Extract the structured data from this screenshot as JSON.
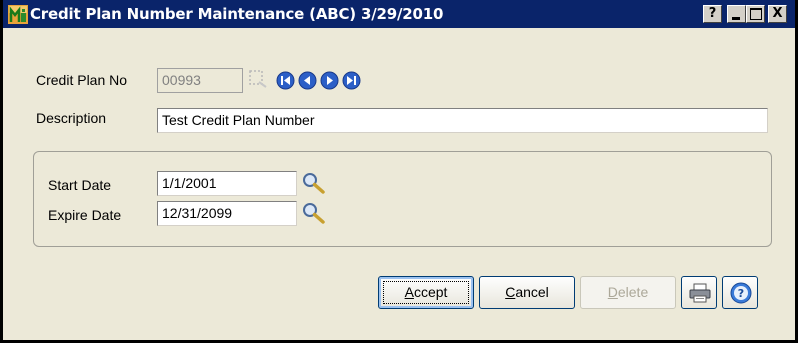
{
  "window": {
    "title": "Credit Plan Number Maintenance (ABC) 3/29/2010",
    "help_button": "?",
    "minimize_button": "_",
    "maximize_button": "□",
    "close_button": "X"
  },
  "form": {
    "credit_plan_no_label": "Credit Plan No",
    "credit_plan_no_value": "00993",
    "description_label": "Description",
    "description_value": "Test Credit Plan Number",
    "start_date_label": "Start Date",
    "start_date_value": "1/1/2001",
    "expire_date_label": "Expire Date",
    "expire_date_value": "12/31/2099"
  },
  "buttons": {
    "accept_access": "A",
    "accept_rest": "ccept",
    "cancel_access": "C",
    "cancel_rest": "ancel",
    "delete_access": "D",
    "delete_rest": "elete"
  },
  "icons": [
    "app-icon",
    "lookup-icon",
    "first-record-icon",
    "previous-record-icon",
    "next-record-icon",
    "last-record-icon",
    "date-lookup-icon",
    "printer-icon",
    "help-icon"
  ],
  "colors": {
    "titlebar": "#0a246a",
    "window_bg": "#ece9d8",
    "nav_blue": "#2c5fc7"
  }
}
